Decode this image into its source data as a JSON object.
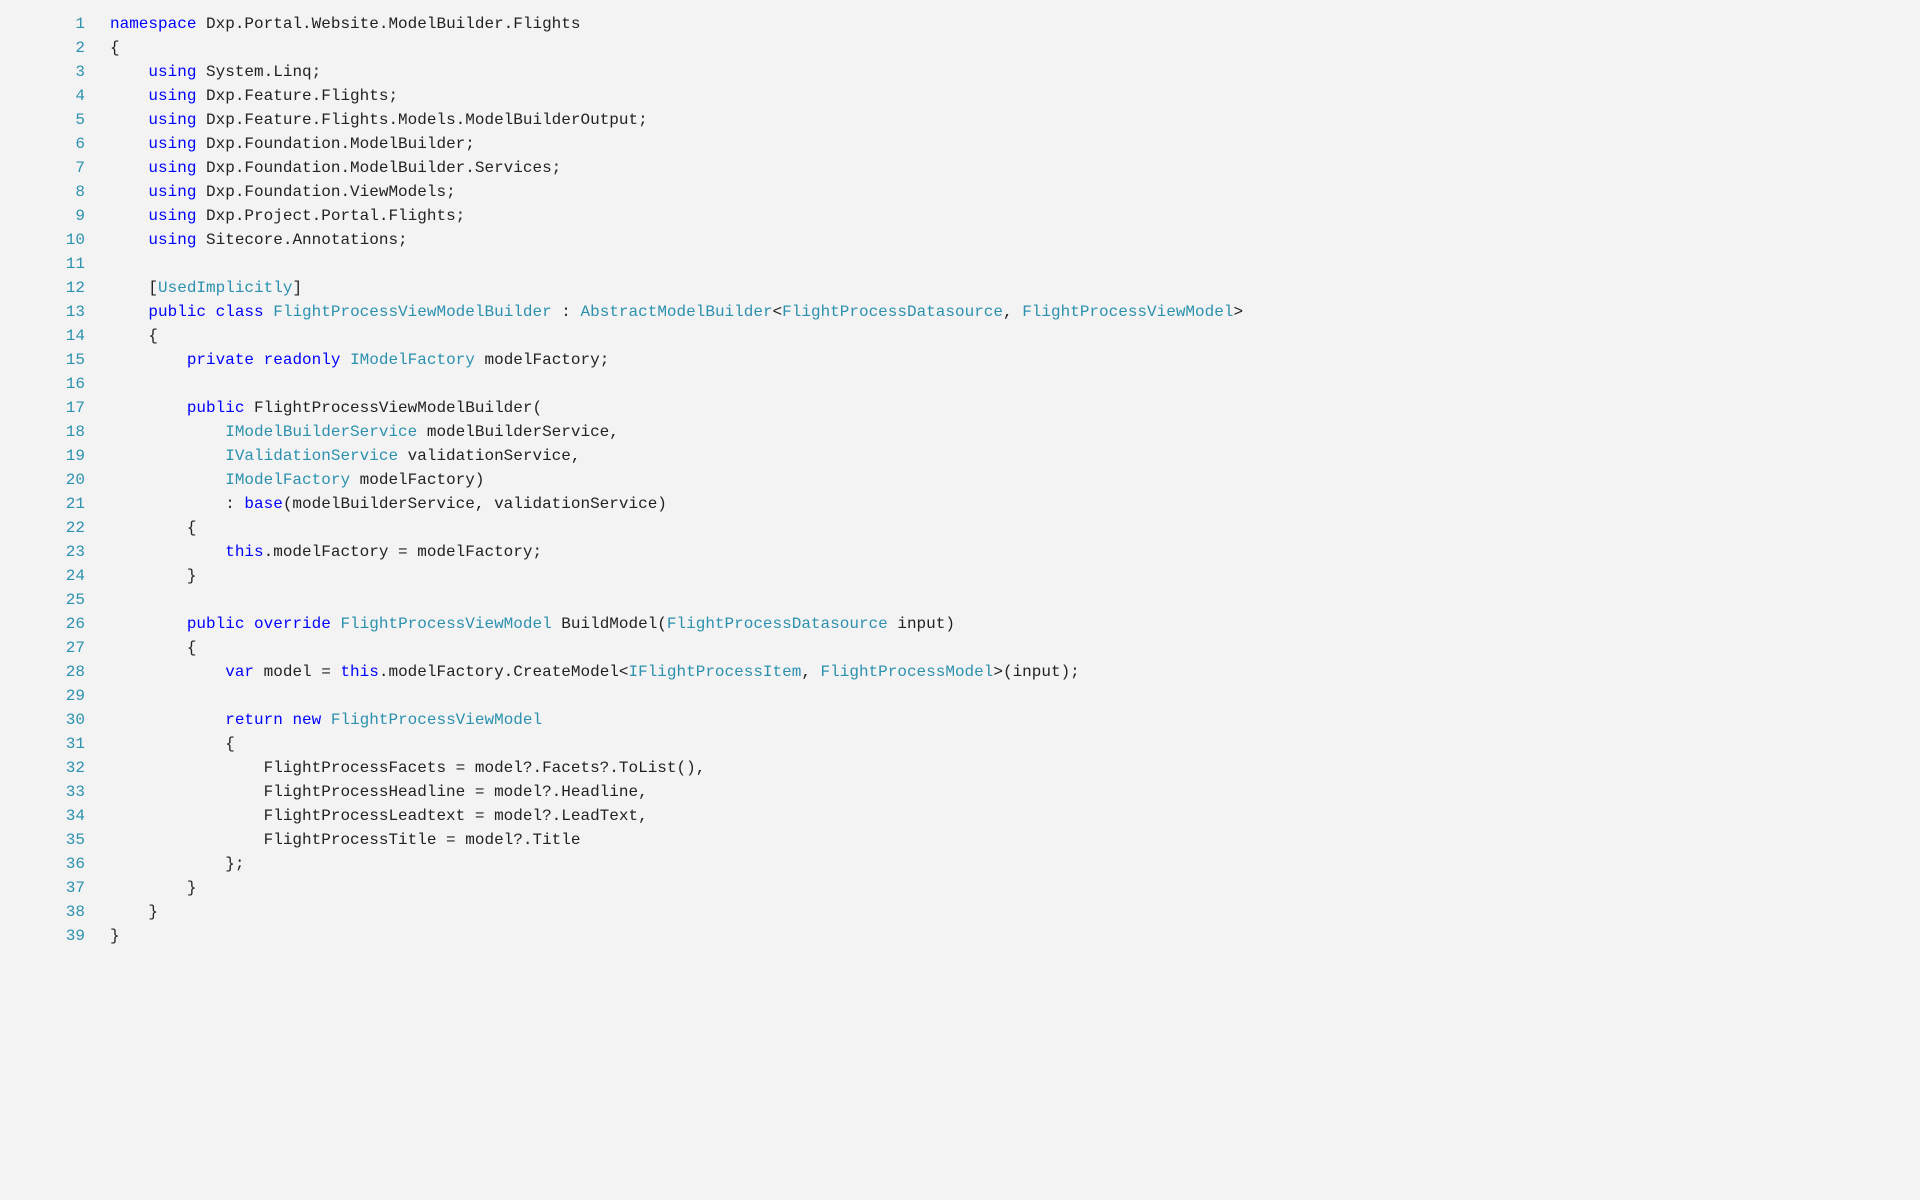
{
  "code": {
    "lines": [
      {
        "n": 1,
        "t": [
          [
            "kw",
            "namespace"
          ],
          [
            "plain",
            " Dxp.Portal.Website.ModelBuilder.Flights"
          ]
        ]
      },
      {
        "n": 2,
        "t": [
          [
            "plain",
            "{"
          ]
        ]
      },
      {
        "n": 3,
        "t": [
          [
            "plain",
            "    "
          ],
          [
            "kw",
            "using"
          ],
          [
            "plain",
            " System.Linq;"
          ]
        ]
      },
      {
        "n": 4,
        "t": [
          [
            "plain",
            "    "
          ],
          [
            "kw",
            "using"
          ],
          [
            "plain",
            " Dxp.Feature.Flights;"
          ]
        ]
      },
      {
        "n": 5,
        "t": [
          [
            "plain",
            "    "
          ],
          [
            "kw",
            "using"
          ],
          [
            "plain",
            " Dxp.Feature.Flights.Models.ModelBuilderOutput;"
          ]
        ]
      },
      {
        "n": 6,
        "t": [
          [
            "plain",
            "    "
          ],
          [
            "kw",
            "using"
          ],
          [
            "plain",
            " Dxp.Foundation.ModelBuilder;"
          ]
        ]
      },
      {
        "n": 7,
        "t": [
          [
            "plain",
            "    "
          ],
          [
            "kw",
            "using"
          ],
          [
            "plain",
            " Dxp.Foundation.ModelBuilder.Services;"
          ]
        ]
      },
      {
        "n": 8,
        "t": [
          [
            "plain",
            "    "
          ],
          [
            "kw",
            "using"
          ],
          [
            "plain",
            " Dxp.Foundation.ViewModels;"
          ]
        ]
      },
      {
        "n": 9,
        "t": [
          [
            "plain",
            "    "
          ],
          [
            "kw",
            "using"
          ],
          [
            "plain",
            " Dxp.Project.Portal.Flights;"
          ]
        ]
      },
      {
        "n": 10,
        "t": [
          [
            "plain",
            "    "
          ],
          [
            "kw",
            "using"
          ],
          [
            "plain",
            " Sitecore.Annotations;"
          ]
        ]
      },
      {
        "n": 11,
        "t": []
      },
      {
        "n": 12,
        "t": [
          [
            "plain",
            "    ["
          ],
          [
            "type",
            "UsedImplicitly"
          ],
          [
            "plain",
            "]"
          ]
        ]
      },
      {
        "n": 13,
        "t": [
          [
            "plain",
            "    "
          ],
          [
            "kw",
            "public"
          ],
          [
            "plain",
            " "
          ],
          [
            "kw",
            "class"
          ],
          [
            "plain",
            " "
          ],
          [
            "type",
            "FlightProcessViewModelBuilder"
          ],
          [
            "plain",
            " : "
          ],
          [
            "type",
            "AbstractModelBuilder"
          ],
          [
            "plain",
            "<"
          ],
          [
            "type",
            "FlightProcessDatasource"
          ],
          [
            "plain",
            ", "
          ],
          [
            "type",
            "FlightProcessViewModel"
          ],
          [
            "plain",
            ">"
          ]
        ]
      },
      {
        "n": 14,
        "t": [
          [
            "plain",
            "    {"
          ]
        ]
      },
      {
        "n": 15,
        "t": [
          [
            "plain",
            "        "
          ],
          [
            "kw",
            "private"
          ],
          [
            "plain",
            " "
          ],
          [
            "kw",
            "readonly"
          ],
          [
            "plain",
            " "
          ],
          [
            "type",
            "IModelFactory"
          ],
          [
            "plain",
            " modelFactory;"
          ]
        ]
      },
      {
        "n": 16,
        "t": []
      },
      {
        "n": 17,
        "t": [
          [
            "plain",
            "        "
          ],
          [
            "kw",
            "public"
          ],
          [
            "plain",
            " FlightProcessViewModelBuilder("
          ]
        ]
      },
      {
        "n": 18,
        "t": [
          [
            "plain",
            "            "
          ],
          [
            "type",
            "IModelBuilderService"
          ],
          [
            "plain",
            " modelBuilderService,"
          ]
        ]
      },
      {
        "n": 19,
        "t": [
          [
            "plain",
            "            "
          ],
          [
            "type",
            "IValidationService"
          ],
          [
            "plain",
            " validationService,"
          ]
        ]
      },
      {
        "n": 20,
        "t": [
          [
            "plain",
            "            "
          ],
          [
            "type",
            "IModelFactory"
          ],
          [
            "plain",
            " modelFactory)"
          ]
        ]
      },
      {
        "n": 21,
        "t": [
          [
            "plain",
            "            : "
          ],
          [
            "kw",
            "base"
          ],
          [
            "plain",
            "(modelBuilderService, validationService)"
          ]
        ]
      },
      {
        "n": 22,
        "t": [
          [
            "plain",
            "        {"
          ]
        ]
      },
      {
        "n": 23,
        "t": [
          [
            "plain",
            "            "
          ],
          [
            "kw",
            "this"
          ],
          [
            "plain",
            ".modelFactory = modelFactory;"
          ]
        ]
      },
      {
        "n": 24,
        "t": [
          [
            "plain",
            "        }"
          ]
        ]
      },
      {
        "n": 25,
        "t": []
      },
      {
        "n": 26,
        "t": [
          [
            "plain",
            "        "
          ],
          [
            "kw",
            "public"
          ],
          [
            "plain",
            " "
          ],
          [
            "kw",
            "override"
          ],
          [
            "plain",
            " "
          ],
          [
            "type",
            "FlightProcessViewModel"
          ],
          [
            "plain",
            " BuildModel("
          ],
          [
            "type",
            "FlightProcessDatasource"
          ],
          [
            "plain",
            " input)"
          ]
        ]
      },
      {
        "n": 27,
        "t": [
          [
            "plain",
            "        {"
          ]
        ]
      },
      {
        "n": 28,
        "t": [
          [
            "plain",
            "            "
          ],
          [
            "kw",
            "var"
          ],
          [
            "plain",
            " model = "
          ],
          [
            "kw",
            "this"
          ],
          [
            "plain",
            ".modelFactory.CreateModel<"
          ],
          [
            "type",
            "IFlightProcessItem"
          ],
          [
            "plain",
            ", "
          ],
          [
            "type",
            "FlightProcessModel"
          ],
          [
            "plain",
            ">(input);"
          ]
        ]
      },
      {
        "n": 29,
        "t": []
      },
      {
        "n": 30,
        "t": [
          [
            "plain",
            "            "
          ],
          [
            "kw",
            "return"
          ],
          [
            "plain",
            " "
          ],
          [
            "kw",
            "new"
          ],
          [
            "plain",
            " "
          ],
          [
            "type",
            "FlightProcessViewModel"
          ]
        ]
      },
      {
        "n": 31,
        "t": [
          [
            "plain",
            "            {"
          ]
        ]
      },
      {
        "n": 32,
        "t": [
          [
            "plain",
            "                FlightProcessFacets = model?.Facets?.ToList(),"
          ]
        ]
      },
      {
        "n": 33,
        "t": [
          [
            "plain",
            "                FlightProcessHeadline = model?.Headline,"
          ]
        ]
      },
      {
        "n": 34,
        "t": [
          [
            "plain",
            "                FlightProcessLeadtext = model?.LeadText,"
          ]
        ]
      },
      {
        "n": 35,
        "t": [
          [
            "plain",
            "                FlightProcessTitle = model?.Title"
          ]
        ]
      },
      {
        "n": 36,
        "t": [
          [
            "plain",
            "            };"
          ]
        ]
      },
      {
        "n": 37,
        "t": [
          [
            "plain",
            "        }"
          ]
        ]
      },
      {
        "n": 38,
        "t": [
          [
            "plain",
            "    }"
          ]
        ]
      },
      {
        "n": 39,
        "t": [
          [
            "plain",
            "}"
          ]
        ]
      }
    ]
  }
}
